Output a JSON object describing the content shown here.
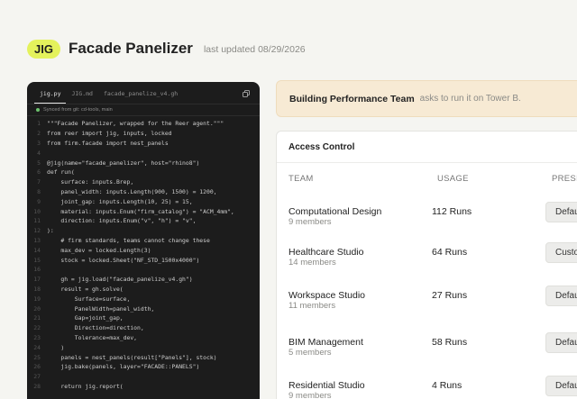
{
  "header": {
    "brand": "JIG",
    "title": "Facade Panelizer",
    "updated": "last updated 08/29/2026"
  },
  "code": {
    "tabs": [
      "jig.py",
      "JIG.md",
      "facade_panelize_v4.gh"
    ],
    "synced": "Synced from git: cd-tools, main",
    "lines": [
      {
        "n": "1",
        "t": "\"\"\"Facade Panelizer, wrapped for the Reer agent.\"\"\""
      },
      {
        "n": "2",
        "t": "from reer import jig, inputs, locked"
      },
      {
        "n": "3",
        "t": "from firm.facade import nest_panels"
      },
      {
        "n": "4",
        "t": ""
      },
      {
        "n": "5",
        "t": "@jig(name=\"facade_panelizer\", host=\"rhino8\")"
      },
      {
        "n": "6",
        "t": "def run("
      },
      {
        "n": "7",
        "t": "    surface: inputs.Brep,"
      },
      {
        "n": "8",
        "t": "    panel_width: inputs.Length(900, 1500) = 1200,"
      },
      {
        "n": "9",
        "t": "    joint_gap: inputs.Length(10, 25) = 15,"
      },
      {
        "n": "10",
        "t": "    material: inputs.Enum(\"firm_catalog\") = \"ACM_4mm\","
      },
      {
        "n": "11",
        "t": "    direction: inputs.Enum(\"v\", \"h\") = \"v\","
      },
      {
        "n": "12",
        "t": "):"
      },
      {
        "n": "13",
        "t": "    # firm standards, teams cannot change these"
      },
      {
        "n": "14",
        "t": "    max_dev = locked.Length(3)"
      },
      {
        "n": "15",
        "t": "    stock = locked.Sheet(\"NF_STD_1500x4000\")"
      },
      {
        "n": "16",
        "t": ""
      },
      {
        "n": "17",
        "t": "    gh = jig.load(\"facade_panelize_v4.gh\")"
      },
      {
        "n": "18",
        "t": "    result = gh.solve("
      },
      {
        "n": "19",
        "t": "        Surface=surface,"
      },
      {
        "n": "20",
        "t": "        PanelWidth=panel_width,"
      },
      {
        "n": "21",
        "t": "        Gap=joint_gap,"
      },
      {
        "n": "22",
        "t": "        Direction=direction,"
      },
      {
        "n": "23",
        "t": "        Tolerance=max_dev,"
      },
      {
        "n": "24",
        "t": "    )"
      },
      {
        "n": "25",
        "t": "    panels = nest_panels(result[\"Panels\"], stock)"
      },
      {
        "n": "26",
        "t": "    jig.bake(panels, layer=\"FACADE::PANELS\")"
      },
      {
        "n": "27",
        "t": ""
      },
      {
        "n": "28",
        "t": "    return jig.report("
      }
    ]
  },
  "banner": {
    "team": "Building Performance Team",
    "message": "asks to run it on Tower B."
  },
  "access": {
    "title": "Access Control",
    "columns": [
      "TEAM",
      "USAGE",
      "PRESET"
    ],
    "rows": [
      {
        "team": "Computational Design",
        "members": "9 members",
        "usage": "112 Runs",
        "preset": "Default"
      },
      {
        "team": "Healthcare Studio",
        "members": "14 members",
        "usage": "64 Runs",
        "preset": "Custom"
      },
      {
        "team": "Workspace Studio",
        "members": "11 members",
        "usage": "27 Runs",
        "preset": "Default"
      },
      {
        "team": "BIM Management",
        "members": "5 members",
        "usage": "58 Runs",
        "preset": "Default"
      },
      {
        "team": "Residential Studio",
        "members": "9 members",
        "usage": "4 Runs",
        "preset": "Default"
      }
    ]
  }
}
